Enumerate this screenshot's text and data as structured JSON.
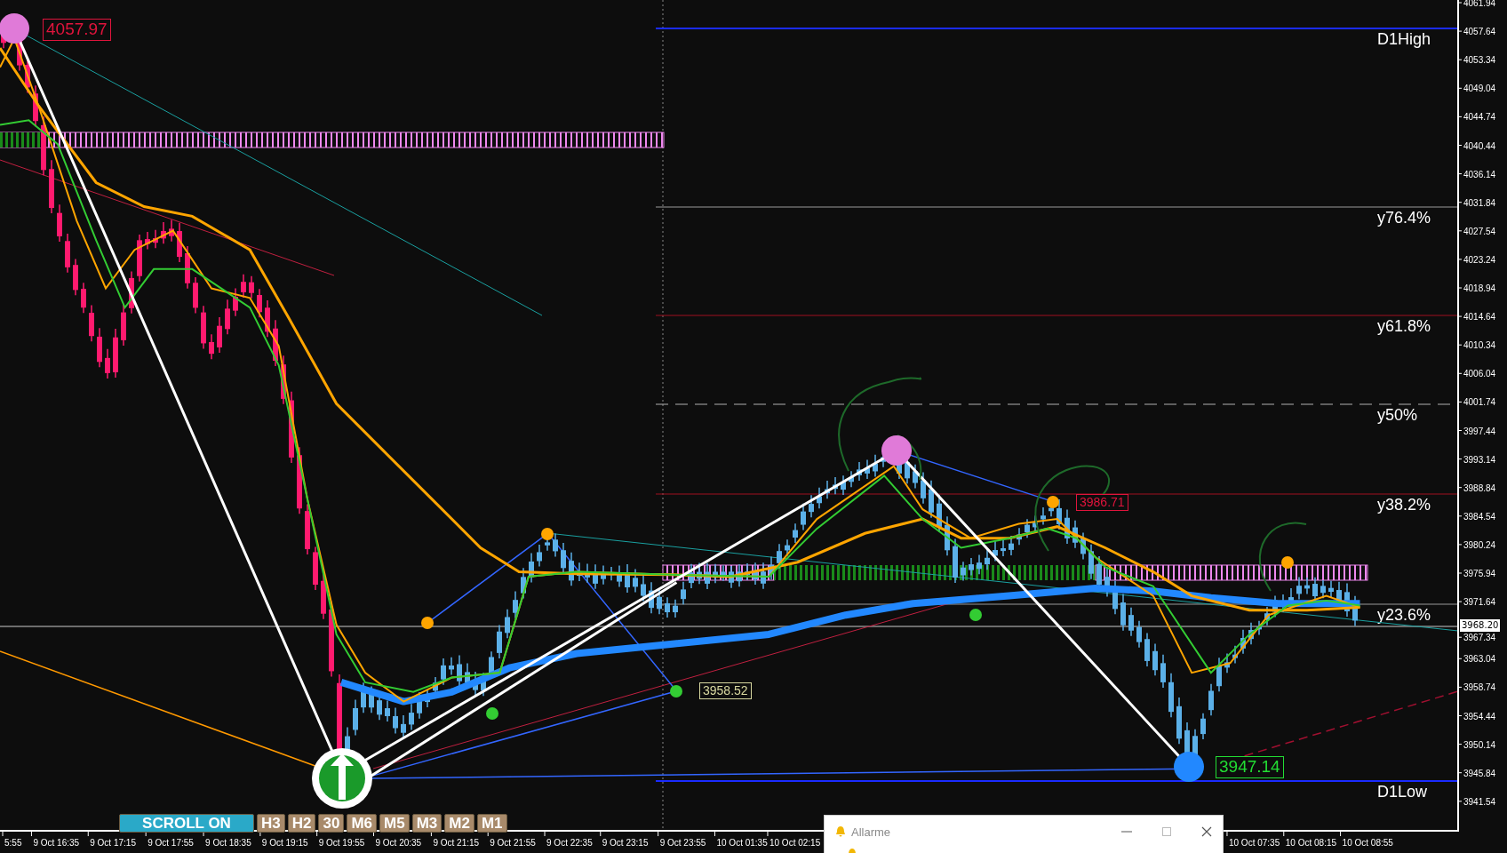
{
  "chart": {
    "price_axis": {
      "ticks": [
        "4061.94",
        "4057.64",
        "4053.34",
        "4049.04",
        "4044.74",
        "4040.44",
        "4036.14",
        "4031.84",
        "4027.54",
        "4023.24",
        "4018.94",
        "4014.64",
        "4010.34",
        "4006.04",
        "4001.74",
        "3997.44",
        "3993.14",
        "3988.84",
        "3984.54",
        "3980.24",
        "3975.94",
        "3971.64",
        "3967.34",
        "3963.04",
        "3958.74",
        "3954.44",
        "3950.14",
        "3945.84",
        "3941.54"
      ]
    },
    "current_price": "3968.20",
    "time_axis": {
      "ticks": [
        "5:55",
        "9 Oct 16:35",
        "9 Oct 17:15",
        "9 Oct 17:55",
        "9 Oct 18:35",
        "9 Oct 19:15",
        "9 Oct 19:55",
        "9 Oct 20:35",
        "9 Oct 21:15",
        "9 Oct 21:55",
        "9 Oct 22:35",
        "9 Oct 23:15",
        "9 Oct 23:55",
        "10 Oct 01:35",
        "10 Oct 02:15",
        "10 Oct 07:35",
        "10 Oct 08:15",
        "10 Oct 08:55"
      ]
    },
    "levels": [
      {
        "label": "D1High",
        "kind": "day-high"
      },
      {
        "label": "y76.4%",
        "kind": "fib-gray"
      },
      {
        "label": "y61.8%",
        "kind": "fib-red"
      },
      {
        "label": "y50%",
        "kind": "fib-dashed"
      },
      {
        "label": "y38.2%",
        "kind": "fib-red"
      },
      {
        "label": "y23.6%",
        "kind": "fib-gray"
      },
      {
        "label": "D1Low",
        "kind": "day-low"
      }
    ],
    "price_labels": [
      {
        "text": "4057.97",
        "kind": "high"
      },
      {
        "text": "3986.71",
        "kind": "high-small"
      },
      {
        "text": "3958.52",
        "kind": "low-small"
      },
      {
        "text": "3947.14",
        "kind": "low"
      }
    ]
  },
  "toolbar": {
    "buttons": [
      {
        "label": "SCROLL ON",
        "kind": "toggle"
      },
      {
        "label": "H3",
        "kind": "timeframe"
      },
      {
        "label": "H2",
        "kind": "timeframe"
      },
      {
        "label": "30",
        "kind": "timeframe"
      },
      {
        "label": "M6",
        "kind": "timeframe"
      },
      {
        "label": "M5",
        "kind": "timeframe"
      },
      {
        "label": "M3",
        "kind": "timeframe"
      },
      {
        "label": "M2",
        "kind": "timeframe"
      },
      {
        "label": "M1",
        "kind": "timeframe"
      }
    ]
  },
  "alarm_window": {
    "title": "Allarme"
  }
}
